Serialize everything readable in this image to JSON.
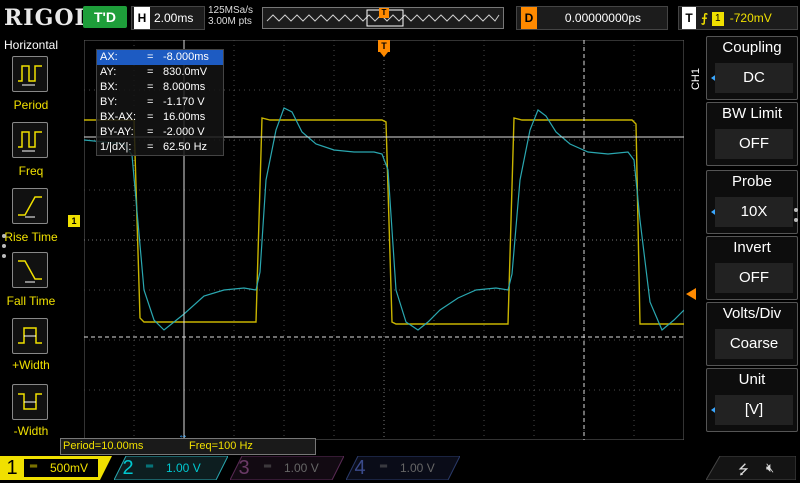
{
  "brand": "RIGOL",
  "top": {
    "trigger_status": "T'D",
    "h_letter": "H",
    "timebase": "2.00ms",
    "sample_rate": "125MSa/s",
    "mem_depth": "3.00M pts",
    "d_letter": "D",
    "delay": "0.00000000ps",
    "t_letter": "T",
    "trig_edge_icon": "rising-edge-icon",
    "trig_source": "1",
    "trig_level": "-720mV"
  },
  "left_menu": {
    "title": "Horizontal",
    "items": [
      {
        "label": "Period",
        "icon": "period-icon"
      },
      {
        "label": "Freq",
        "icon": "freq-icon"
      },
      {
        "label": "Rise Time",
        "icon": "rise-time-icon"
      },
      {
        "label": "Fall Time",
        "icon": "fall-time-icon"
      },
      {
        "label": "+Width",
        "icon": "positive-width-icon"
      },
      {
        "label": "-Width",
        "icon": "negative-width-icon"
      }
    ]
  },
  "right_menu": {
    "channel_label": "CH1",
    "items": [
      {
        "title": "Coupling",
        "value": "DC",
        "has_arrow": true
      },
      {
        "title": "BW Limit",
        "value": "OFF",
        "has_arrow": false
      },
      {
        "title": "Probe",
        "value": "10X",
        "has_arrow": true
      },
      {
        "title": "Invert",
        "value": "OFF",
        "has_arrow": false
      },
      {
        "title": "Volts/Div",
        "value": "Coarse",
        "has_arrow": false
      },
      {
        "title": "Unit",
        "value": "[V]",
        "has_arrow": true
      }
    ]
  },
  "cursor_table": [
    {
      "key": "AX:",
      "value": "-8.000ms",
      "selected": true
    },
    {
      "key": "AY:",
      "value": "830.0mV",
      "selected": false
    },
    {
      "key": "BX:",
      "value": "8.000ms",
      "selected": false
    },
    {
      "key": "BY:",
      "value": "-1.170 V",
      "selected": false
    },
    {
      "key": "BX-AX:",
      "value": "16.00ms",
      "selected": false
    },
    {
      "key": "BY-AY:",
      "value": "-2.000 V",
      "selected": false
    },
    {
      "key": "1/|dX|:",
      "value": "62.50 Hz",
      "selected": false
    }
  ],
  "cursor_eq": "=",
  "measure": {
    "period": "Period=10.00ms",
    "freq": "Freq=100 Hz"
  },
  "markers": {
    "ch1_ground": "1",
    "trig_pos": "T"
  },
  "channels": [
    {
      "num": "1",
      "scale": "500mV",
      "color": "#f0e000",
      "active": true
    },
    {
      "num": "2",
      "scale": "1.00 V",
      "color": "#00c8d0",
      "active": true
    },
    {
      "num": "3",
      "scale": "1.00 V",
      "color": "#d040c0",
      "active": false
    },
    {
      "num": "4",
      "scale": "1.00 V",
      "color": "#2060ff",
      "active": false
    }
  ],
  "status_icons": {
    "usb": "usb-icon",
    "speaker": "speaker-muted-icon"
  },
  "colors": {
    "ch1": "#c8b400",
    "ch2": "#2aa7b0",
    "trigger": "#ff8a00",
    "grid": "#505050"
  }
}
